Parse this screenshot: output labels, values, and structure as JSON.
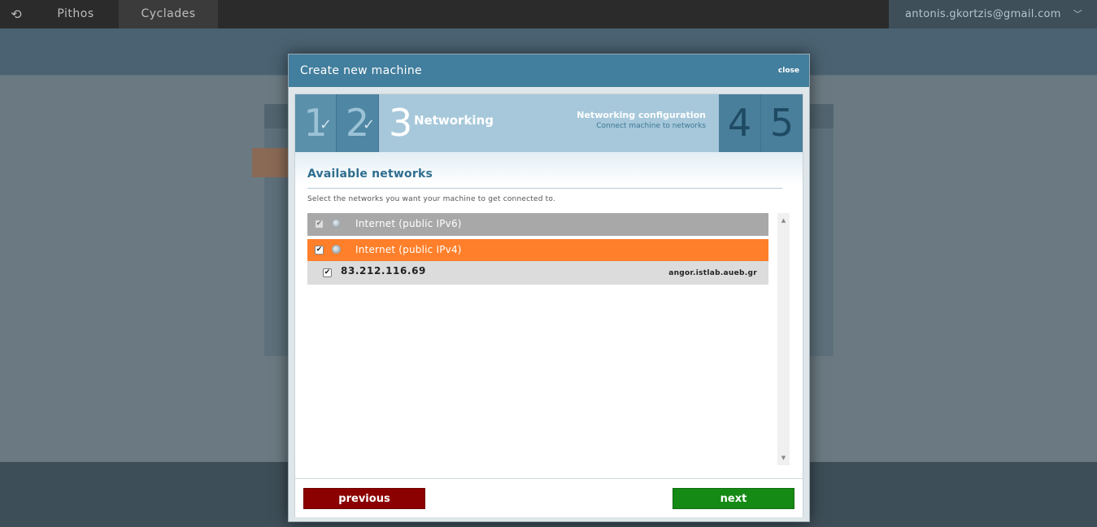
{
  "topbar": {
    "logo_icon": "synnefo-logo-icon",
    "tabs": [
      {
        "label": "Pithos"
      },
      {
        "label": "Cyclades"
      }
    ],
    "user_email": "antonis.gkortzis@gmail.com",
    "user_menu_icon": "chevron-down-icon"
  },
  "modal": {
    "title": "Create new machine",
    "close_label": "close",
    "steps": [
      {
        "number": "1",
        "done": true
      },
      {
        "number": "2",
        "done": true
      },
      {
        "number": "3",
        "name": "Networking",
        "active": true,
        "description_title": "Networking configuration",
        "description_subtitle": "Connect machine to networks"
      },
      {
        "number": "4"
      },
      {
        "number": "5"
      }
    ],
    "section_title": "Available networks",
    "section_description": "Select the networks you want your machine to get connected to.",
    "networks": [
      {
        "label": "Internet (public IPv6)",
        "checked": true,
        "disabled": true,
        "color": "#a8a8a8"
      },
      {
        "label": "Internet (public IPv4)",
        "checked": true,
        "disabled": false,
        "color": "#ff7f2a",
        "ips": [
          {
            "address": "83.212.116.69",
            "hostname": "angor.istlab.aueb.gr",
            "checked": true
          }
        ]
      }
    ],
    "buttons": {
      "previous_label": "previous",
      "next_label": "next",
      "previous_color": "#8b0000",
      "next_color": "#158a15"
    }
  }
}
